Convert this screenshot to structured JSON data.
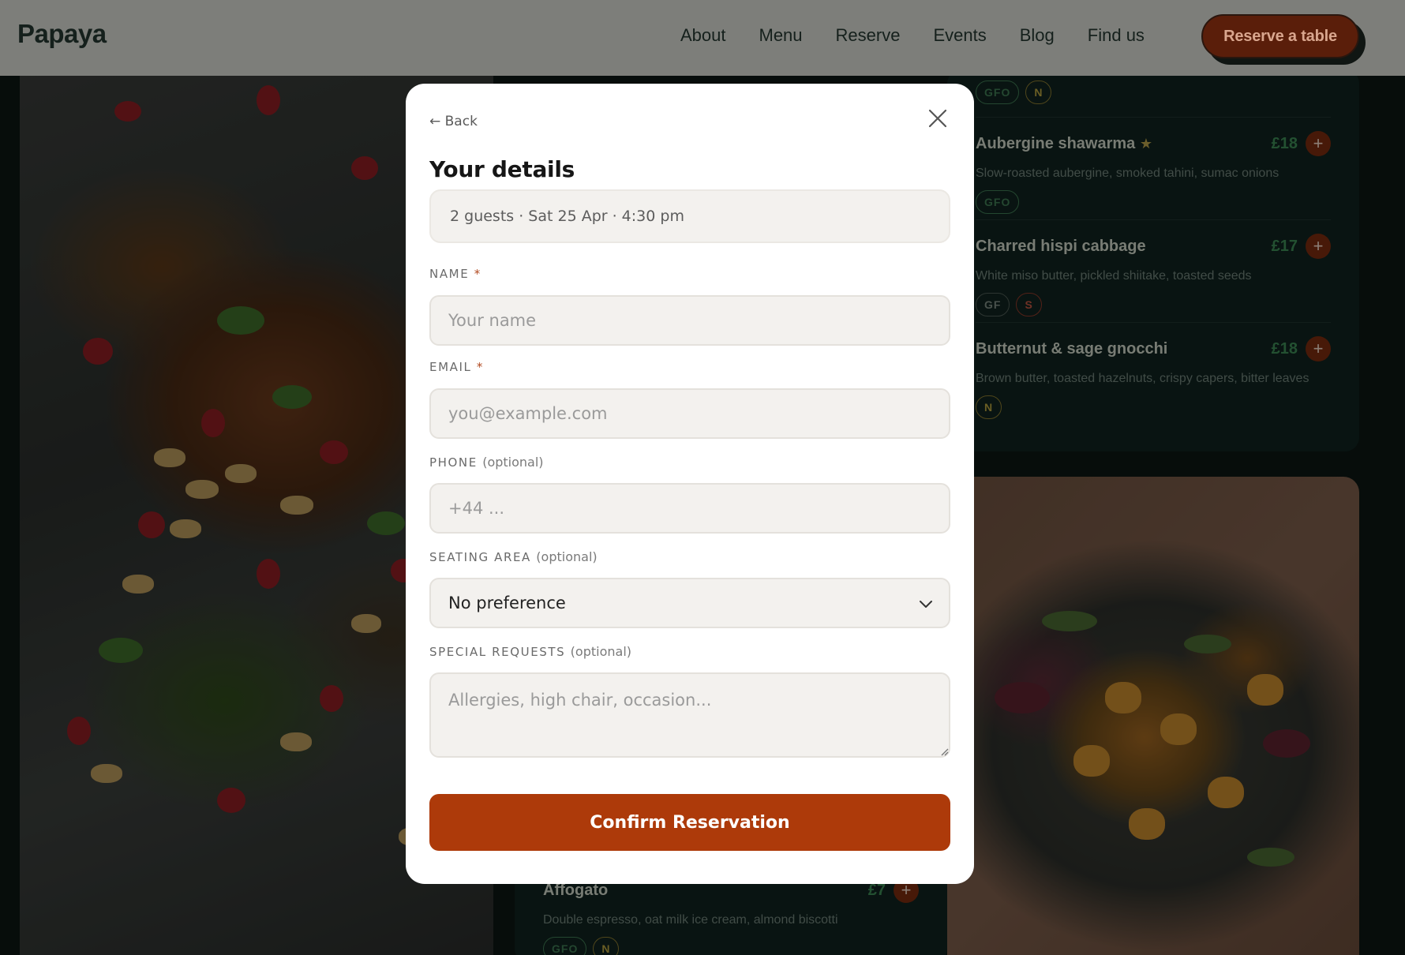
{
  "header": {
    "brand": "Papaya",
    "nav": [
      "About",
      "Menu",
      "Reserve",
      "Events",
      "Blog",
      "Find us"
    ],
    "cta_label": "Reserve a table"
  },
  "menu": {
    "items": [
      {
        "name": "Aubergine shawarma",
        "featured": true,
        "price": "£18",
        "desc": "Slow-roasted aubergine, smoked tahini, sumac onions",
        "tags": [
          "GFO"
        ]
      },
      {
        "name": "Charred hispi cabbage",
        "featured": false,
        "price": "£17",
        "desc": "White miso butter, pickled shiitake, toasted seeds",
        "tags": [
          "GF",
          "S"
        ]
      },
      {
        "name": "Butternut & sage gnocchi",
        "featured": false,
        "price": "£18",
        "desc": "Brown butter, toasted hazelnuts, crispy capers, bitter leaves",
        "tags": [
          "N"
        ]
      }
    ],
    "top_tags": [
      "GFO",
      "N"
    ],
    "bottom_item": {
      "name": "Affogato",
      "price": "£7",
      "desc": "Double espresso, oat milk ice cream, almond biscotti",
      "tags": [
        "GFO",
        "N"
      ]
    },
    "add_symbol": "+"
  },
  "modal": {
    "back_label": "← Back",
    "title": "Your details",
    "summary": "2 guests · Sat 25 Apr · 4:30 pm",
    "name": {
      "label": "NAME",
      "required_mark": "*",
      "placeholder": "Your name",
      "value": ""
    },
    "email": {
      "label": "EMAIL",
      "required_mark": "*",
      "placeholder": "you@example.com",
      "value": ""
    },
    "phone": {
      "label": "PHONE",
      "optional": "(optional)",
      "placeholder": "+44 ...",
      "value": ""
    },
    "seating": {
      "label": "SEATING AREA",
      "optional": "(optional)",
      "selected": "No preference"
    },
    "requests": {
      "label": "SPECIAL REQUESTS",
      "optional": "(optional)",
      "placeholder": "Allergies, high chair, occasion...",
      "value": ""
    },
    "confirm_label": "Confirm Reservation"
  },
  "colors": {
    "accent": "#ad3a0a",
    "page_bg": "#0d1814",
    "header_bg": "#7d7e7a",
    "price_green": "#3d8a55"
  }
}
